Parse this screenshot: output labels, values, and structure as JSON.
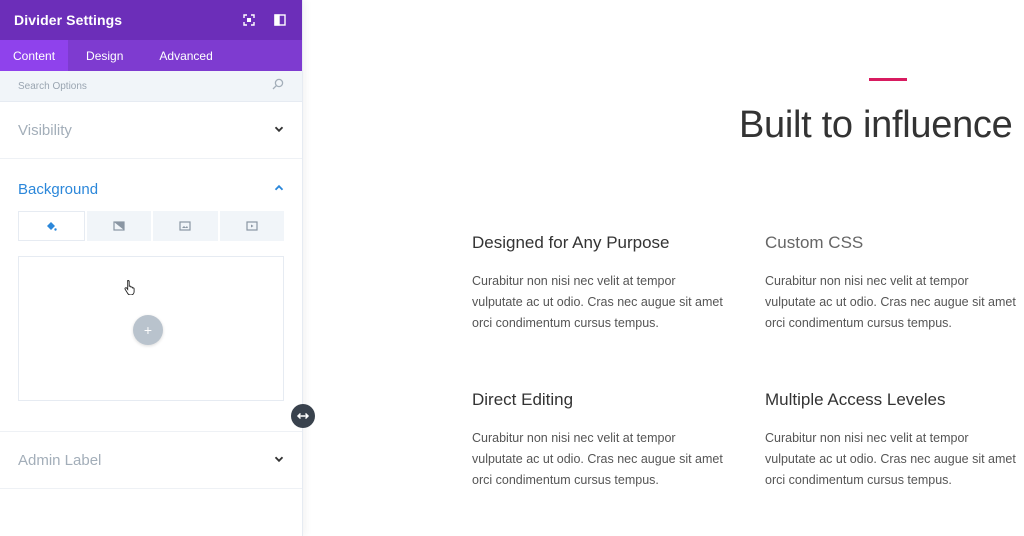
{
  "panel": {
    "title": "Divider Settings",
    "tabs": [
      "Content",
      "Design",
      "Advanced"
    ],
    "search_placeholder": "Search Options",
    "sections": {
      "visibility": "Visibility",
      "background": "Background",
      "admin_label": "Admin Label"
    },
    "add_label": "+",
    "accent_colors": {
      "header": "#6c2eb9",
      "tabs": "#7e3bd0",
      "active_tab": "#8f42ec",
      "section_active": "#2b87da"
    }
  },
  "page": {
    "hero_title": "Built to influence",
    "accent_color": "#d81b60",
    "features": [
      {
        "title": "Designed for Any Purpose",
        "text": "Curabitur non nisi nec velit at tempor vulputate ac ut odio. Cras nec augue sit amet orci condimentum cursus tempus."
      },
      {
        "title": "Custom CSS",
        "text": "Curabitur non nisi nec velit at tempor vulputate ac ut odio. Cras nec augue sit amet orci condimentum cursus tempus."
      },
      {
        "title": "Direct Editing",
        "text": "Curabitur non nisi nec velit at tempor vulputate ac ut odio. Cras nec augue sit amet orci condimentum cursus tempus."
      },
      {
        "title": "Multiple Access Leveles",
        "text": "Curabitur non nisi nec velit at tempor vulputate ac ut odio. Cras nec augue sit amet orci condimentum cursus tempus."
      }
    ]
  }
}
